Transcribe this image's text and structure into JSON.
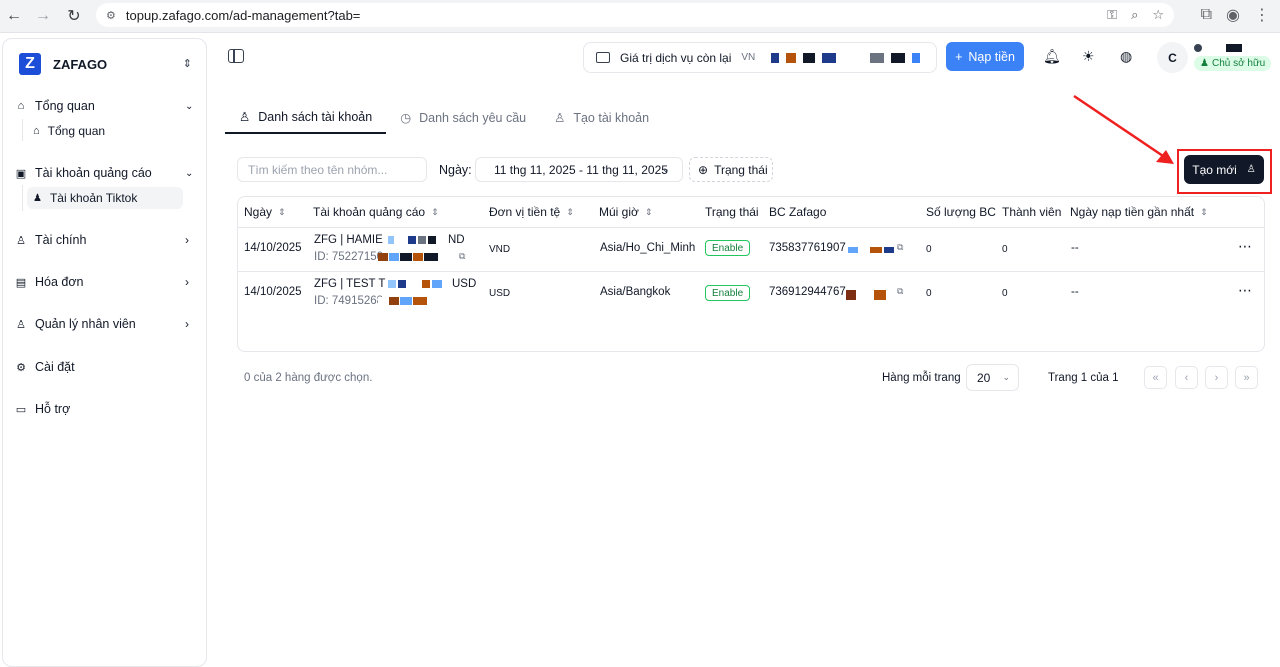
{
  "browser": {
    "url": "topup.zafago.com/ad-management?tab="
  },
  "sidebar": {
    "brand": "ZAFAGO",
    "logo_letter": "Z",
    "groups": [
      {
        "label": "Tổng quan",
        "icon": "home-icon",
        "children": [
          {
            "label": "Tổng quan",
            "icon": "home-icon"
          }
        ]
      },
      {
        "label": "Tài khoản quảng cáo",
        "icon": "box-icon",
        "children": [
          {
            "label": "Tài khoản Tiktok",
            "icon": "users-icon",
            "active": true
          }
        ]
      },
      {
        "label": "Tài chính",
        "icon": "wallet-icon"
      },
      {
        "label": "Hóa đơn",
        "icon": "receipt-icon"
      },
      {
        "label": "Quản lý nhân viên",
        "icon": "user-cog-icon"
      },
      {
        "label": "Cài đặt",
        "icon": "gear-icon"
      },
      {
        "label": "Hỗ trợ",
        "icon": "message-icon"
      }
    ]
  },
  "header": {
    "balance_label": "Giá trị dịch vụ còn lại",
    "balance_currency": "VN",
    "topup_label": "Nạp tiền",
    "avatar_initial": "C",
    "role_badge": "Chủ sở hữu",
    "accent_color": "#3b82f6"
  },
  "tabs": [
    {
      "label": "Danh sách tài khoản",
      "icon": "user-icon",
      "active": true
    },
    {
      "label": "Danh sách yêu cầu",
      "icon": "clock-icon",
      "active": false
    },
    {
      "label": "Tạo tài khoản",
      "icon": "user-plus-icon",
      "active": false
    }
  ],
  "filters": {
    "search_placeholder": "Tìm kiếm theo tên nhóm...",
    "date_label": "Ngày:",
    "date_range": "11 thg 11, 2025 - 11 thg 11, 2025",
    "status_label": "Trạng thái",
    "create_label": "Tạo mới"
  },
  "table": {
    "headers": [
      "Ngày",
      "Tài khoản quảng cáo",
      "Đơn vị tiền tệ",
      "Múi giờ",
      "Trạng thái",
      "BC Zafago",
      "Số lượng BC",
      "Thành viên",
      "Ngày nạp tiền gần nhất"
    ],
    "rows": [
      {
        "date": "14/10/2025",
        "account_name": "ZFG | HAMIE",
        "account_suffix": "ND",
        "account_id": "ID: 75227150",
        "currency": "VND",
        "timezone": "Asia/Ho_Chi_Minh",
        "status": "Enable",
        "bc": "735837761907",
        "bc_count": "0",
        "members": "0",
        "last_topup": "--"
      },
      {
        "date": "14/10/2025",
        "account_name": "ZFG | TEST T",
        "account_suffix": "USD",
        "account_id": "ID: 74915268",
        "currency": "USD",
        "timezone": "Asia/Bangkok",
        "status": "Enable",
        "bc": "736912944767",
        "bc_count": "0",
        "members": "0",
        "last_topup": "--"
      }
    ]
  },
  "pagination": {
    "selected_text": "0 của 2 hàng được chọn.",
    "rows_per_page_label": "Hàng mỗi trang",
    "rows_per_page": "20",
    "page_text": "Trang 1 của 1"
  }
}
